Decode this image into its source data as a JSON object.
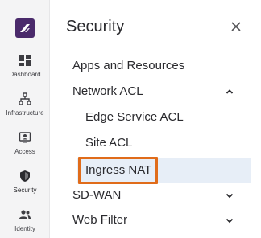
{
  "app": {
    "logo_icon": "brand-logo-icon",
    "accent": "#4a2a6b"
  },
  "rail": {
    "items": [
      {
        "label": "Dashboard",
        "icon": "dashboard-icon"
      },
      {
        "label": "Infrastructure",
        "icon": "infrastructure-icon"
      },
      {
        "label": "Access",
        "icon": "access-icon"
      },
      {
        "label": "Security",
        "icon": "shield-icon"
      },
      {
        "label": "Identity",
        "icon": "identity-icon"
      }
    ]
  },
  "panel": {
    "title": "Security",
    "close_icon": "close-icon",
    "items": [
      {
        "label": "Apps and Resources"
      },
      {
        "label": "Network ACL",
        "expanded": true
      },
      {
        "label": "Edge Service ACL"
      },
      {
        "label": "Site ACL"
      },
      {
        "label": "Ingress NAT",
        "selected": true,
        "highlight": "#e06c1a"
      },
      {
        "label": "SD-WAN",
        "expanded": false
      },
      {
        "label": "Web Filter",
        "expanded": false
      }
    ]
  }
}
